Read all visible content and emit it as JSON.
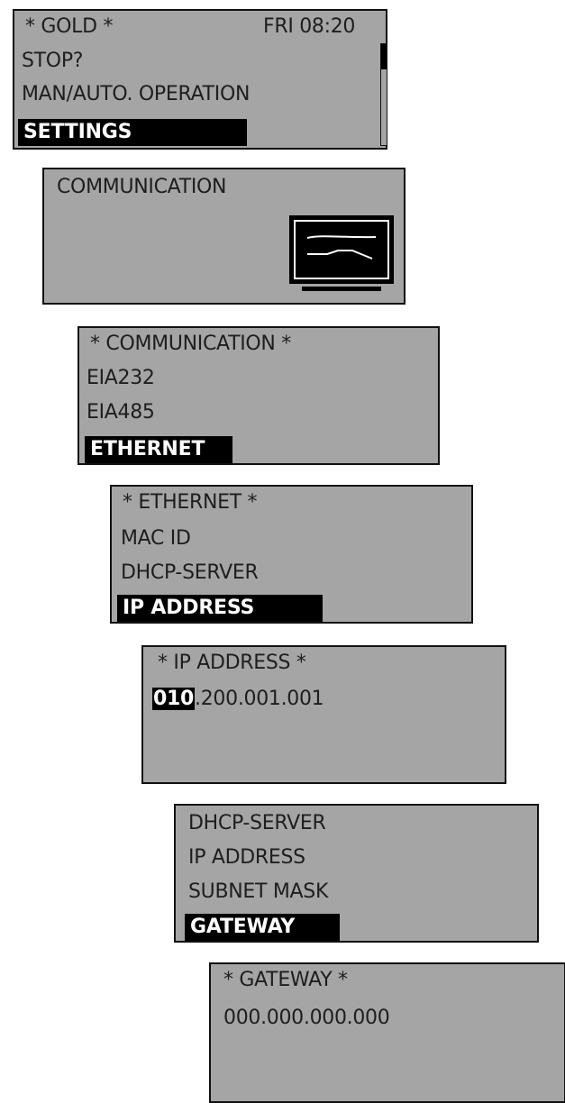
{
  "screen1": {
    "title": "* GOLD *",
    "clock": "FRI 08:20",
    "items": [
      "STOP?",
      "MAN/AUTO. OPERATION"
    ],
    "selected": "SETTINGS"
  },
  "screen2": {
    "title": "COMMUNICATION",
    "icon": "monitor-icon"
  },
  "screen3": {
    "title": "* COMMUNICATION *",
    "items": [
      "EIA232",
      "EIA485"
    ],
    "selected": "ETHERNET"
  },
  "screen4": {
    "title": "* ETHERNET *",
    "items": [
      "MAC ID",
      "DHCP-SERVER"
    ],
    "selected": "IP ADDRESS"
  },
  "screen5": {
    "title": "* IP ADDRESS *",
    "octet_active": "010",
    "rest": ".200.001.001"
  },
  "screen6": {
    "items": [
      "DHCP-SERVER",
      "IP ADDRESS",
      "SUBNET MASK"
    ],
    "selected": "GATEWAY"
  },
  "screen7": {
    "title": "* GATEWAY *",
    "value": "000.000.000.000"
  },
  "colors": {
    "screen_bg": "#a5a5a5",
    "border": "#111111",
    "highlight_bg": "#000000",
    "highlight_fg": "#ffffff"
  }
}
